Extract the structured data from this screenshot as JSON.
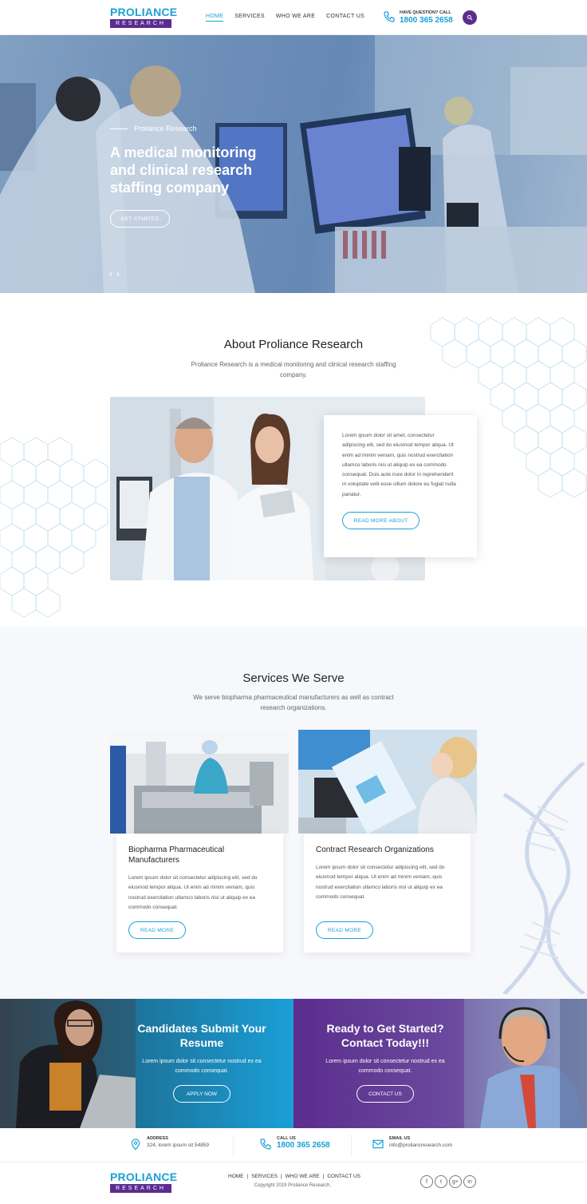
{
  "header": {
    "logo_top": "PROLIANCE",
    "logo_bottom": "RESEARCH",
    "nav": [
      "HOME",
      "SERVICES",
      "WHO WE ARE",
      "CONTACT US"
    ],
    "question": "HAVE QUESTION? CALL",
    "phone": "1800 365 2658"
  },
  "hero": {
    "eyebrow": "Proliance Research",
    "title": "A medical monitoring and clinical research staffing company",
    "button": "GET STARTED",
    "prev": "‹",
    "next": "›"
  },
  "about": {
    "title": "About Proliance Research",
    "subtitle": "Proliance Research is a medical monitoring and clinical research staffing company.",
    "body": "Lorem ipsum dolor sit amet, consectetur adipiscing elit, sed do eiusmod tempor aliqua. Ut enim ad minim veniam, quis nostrud exercitation ullamco laboris nisi ut aliquip ex ea commodo consequat. Duis aute irure dolor in reprehenderit in voluptate velit esse cillum dolore eu fugiat nulla pariatur.",
    "button": "READ MORE ABOUT"
  },
  "services": {
    "title": "Services We Serve",
    "subtitle": "We serve biopharma pharmaceutical manufacturers as well as contract research organizations.",
    "cards": [
      {
        "title": "Biopharma Pharmaceutical Manufacturers",
        "body": "Lorem ipsum dolor sit consectetur adipiscing elit, sed do eiusmod tempor aliqua. Ut enim ad minim veniam, quis nostrud exercitation ullamco laboris nisi ut aliquip ex ea commodo consequat.",
        "button": "READ MORE"
      },
      {
        "title": "Contract Research Organizations",
        "body": "Lorem ipsum dolor sit consectetur adipiscing elit, sed do eiusmod tempor aliqua. Ut enim ad minim veniam, quis nostrud exercitation ullamco laboris nisi ut aliquip ex ea commodo consequat.",
        "button": "READ MORE"
      }
    ]
  },
  "cta": {
    "left": {
      "title": "Candidates Submit Your Resume",
      "body": "Lorem ipsum dolor sit consectetur nostrud ex ea commodo consequat.",
      "button": "APPLY NOW"
    },
    "right": {
      "title": "Ready to Get Started? Contact Today!!!",
      "body": "Lorem ipsum dolor sit consectetur nostrud ex ea commodo consequat.",
      "button": "CONTACT US"
    }
  },
  "contact": {
    "address_label": "ADDRESS",
    "address": "324, lorem ipsum sit 54859",
    "call_label": "CALL US",
    "call": "1800 365 2658",
    "email_label": "EMAIL US",
    "email": "info@proliancresearch.com"
  },
  "footer": {
    "links": [
      "HOME",
      "SERVICES",
      "WHO WE ARE",
      "CONTACT US"
    ],
    "separator": "|",
    "copyright": "Copyright 2019 Proliance Research.",
    "social": [
      "f",
      "t",
      "g+",
      "in"
    ]
  },
  "colors": {
    "brand_blue": "#1ba0d7",
    "brand_purple": "#5b2d8e"
  }
}
